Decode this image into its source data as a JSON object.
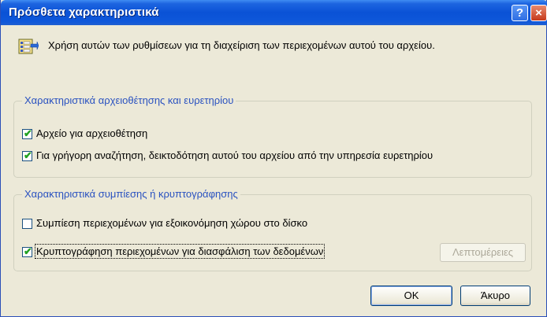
{
  "window": {
    "title": "Πρόσθετα χαρακτηριστικά",
    "help_glyph": "?",
    "close_glyph": "×"
  },
  "header": {
    "text": "Χρήση αυτών των ρυθμίσεων για τη διαχείριση των περιεχομένων αυτού του αρχείου.",
    "icon": "properties-icon"
  },
  "archive_group": {
    "legend": "Χαρακτηριστικά αρχειοθέτησης και ευρετηρίου",
    "items": [
      {
        "label": "Αρχείο για αρχειοθέτηση",
        "checked": true
      },
      {
        "label": "Για γρήγορη αναζήτηση, δεικτοδότηση αυτού του αρχείου  από την υπηρεσία ευρετηρίου",
        "checked": true
      }
    ]
  },
  "compress_group": {
    "legend": "Χαρακτηριστικά συμπίεσης ή κρυπτογράφησης",
    "items": [
      {
        "label": "Συμπίεση περιεχομένων για εξοικονόμηση χώρου στο δίσκο",
        "checked": false
      },
      {
        "label": "Κρυπτογράφηση περιεχομένων για διασφάλιση των δεδομένων",
        "checked": true
      }
    ],
    "details_label": "Λεπτομέρειες"
  },
  "buttons": {
    "ok": "OK",
    "cancel": "Άκυρο"
  },
  "colors": {
    "titlebar": "#0a52d6",
    "legend": "#2a52c0",
    "face": "#ece9d8",
    "check": "#21a121"
  }
}
